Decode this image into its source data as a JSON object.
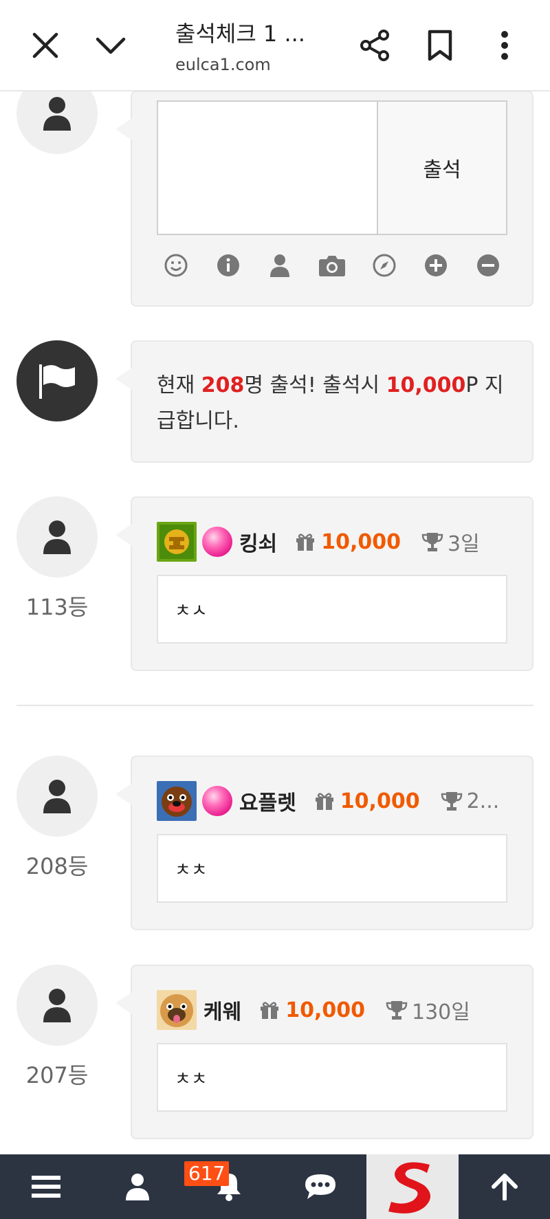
{
  "browser": {
    "title": "출석체크 1 ...",
    "url": "eulca1.com",
    "icons": [
      "close-icon",
      "chevron-down-icon",
      "share-icon",
      "bookmark-icon",
      "more-vert-icon"
    ]
  },
  "attendance_form": {
    "submit_label": "출석",
    "tools": [
      "emoji-icon",
      "info-icon",
      "user-icon",
      "camera-icon",
      "compass-icon",
      "plus-circle-icon",
      "minus-circle-icon"
    ]
  },
  "notice": {
    "prefix": "현재 ",
    "count": "208",
    "middle": "명 출석! 출석시 ",
    "points": "10,000",
    "suffix": "P 지급합니다."
  },
  "entries": [
    {
      "rank": "113등",
      "nickname": "킹쇠",
      "has_level_badge": true,
      "points": "10,000",
      "days": "3일",
      "comment": "ㅊㅅ"
    },
    {
      "rank": "208등",
      "nickname": "요플렛",
      "has_level_badge": true,
      "points": "10,000",
      "days": "2...",
      "comment": "ㅊㅊ"
    },
    {
      "rank": "207등",
      "nickname": "케웨",
      "has_level_badge": false,
      "points": "10,000",
      "days": "130일",
      "comment": "ㅊㅊ"
    }
  ],
  "bottom_nav": {
    "items": [
      "menu-icon",
      "user-icon",
      "bell-icon",
      "chat-icon",
      "site-logo",
      "arrow-up-icon"
    ],
    "notification_count": "617"
  },
  "colors": {
    "accent_red": "#e02020",
    "points_orange": "#f05a00",
    "bottom_bar": "#2c3442",
    "badge": "#ff4f14"
  }
}
